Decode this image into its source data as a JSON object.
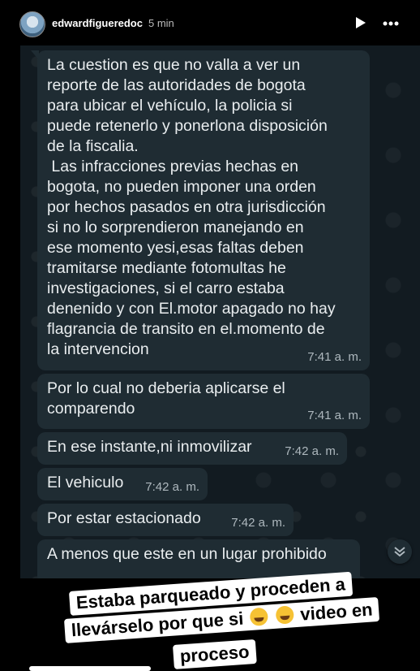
{
  "header": {
    "username": "edwardfigueredoc",
    "time": "5 min",
    "icons": [
      "avatar",
      "play-icon",
      "more-icon"
    ]
  },
  "chat": {
    "messages": [
      {
        "text": "La cuestion es que no valla a ver un\nreporte de las autoridades de bogota\npara ubicar el vehículo, la policia si\npuede retenerlo y ponerlona disposición\nde la fiscalia.\n Las infracciones previas hechas en\nbogota, no pueden imponer una orden\npor hechos pasados en otra jurisdicción\nsi no lo sorprendieron manejando en\nese momento yesi,esas faltas deben\ntramitarse mediante fotomultas he\ninvestigaciones, si el carro estaba\ndenenido y con El.motor apagado no hay\nflagrancia de transito en el.momento de\nla intervencion",
        "time": "7:41 a. m."
      },
      {
        "text": "Por lo cual no deberia aplicarse el\ncomparendo",
        "time": "7:41 a. m."
      },
      {
        "text": "En ese instante,ni inmovilizar",
        "time": "7:42 a. m."
      },
      {
        "text": "El vehiculo",
        "time": "7:42 a. m."
      },
      {
        "text": "Por estar estacionado",
        "time": "7:42 a. m."
      },
      {
        "text": "A menos que este en un lugar prohibido",
        "time": ""
      }
    ]
  },
  "caption": {
    "line1": "Estaba parqueado y proceden a",
    "line2a": "llevárselo por que si",
    "line2b": "video en",
    "line3": "proceso",
    "emojis": [
      "rofl-emoji",
      "sneezing-face-emoji"
    ]
  },
  "colors": {
    "chat_bg": "#121b21",
    "bubble": "#1f2c33",
    "text": "#e9edef",
    "timestamp": "#aeb8be",
    "caption_bg": "#ffffff"
  }
}
